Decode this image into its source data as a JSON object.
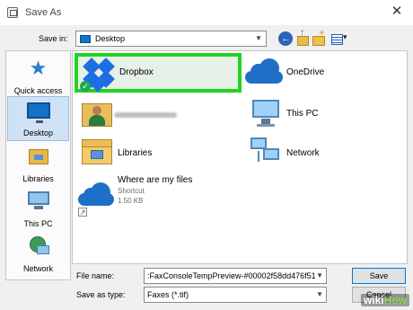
{
  "window": {
    "title": "Save As"
  },
  "save_in": {
    "label": "Save in:",
    "value": "Desktop"
  },
  "places": [
    {
      "label": "Quick access",
      "icon": "quick-access-star-icon"
    },
    {
      "label": "Desktop",
      "icon": "desktop-icon",
      "selected": true
    },
    {
      "label": "Libraries",
      "icon": "libraries-icon"
    },
    {
      "label": "This PC",
      "icon": "this-pc-icon"
    },
    {
      "label": "Network",
      "icon": "network-icon"
    }
  ],
  "files": [
    {
      "label": "Dropbox",
      "icon": "dropbox-icon",
      "highlighted": true
    },
    {
      "label": "OneDrive",
      "icon": "onedrive-icon"
    },
    {
      "label": "",
      "icon": "user-folder-icon"
    },
    {
      "label": "This PC",
      "icon": "this-pc-icon"
    },
    {
      "label": "Libraries",
      "icon": "libraries-folder-icon"
    },
    {
      "label": "Network",
      "icon": "network-icon"
    },
    {
      "label": "Where are my files",
      "sub1": "Shortcut",
      "sub2": "1.50 KB",
      "icon": "onedrive-shortcut-icon"
    }
  ],
  "file_name": {
    "label": "File name:",
    "value": ":FaxConsoleTempPreview-#00002f58dd476f51"
  },
  "save_as_type": {
    "label": "Save as type:",
    "value": "Faxes (*.tif)"
  },
  "buttons": {
    "save": "Save",
    "cancel": "Cancel"
  },
  "watermark": {
    "wiki": "wiki",
    "how": "How"
  },
  "colors": {
    "highlight_border": "#21d321",
    "dropbox_blue": "#1d6ee3",
    "onedrive_blue": "#1f6fc8",
    "selected_place": "#cfe2f5"
  }
}
